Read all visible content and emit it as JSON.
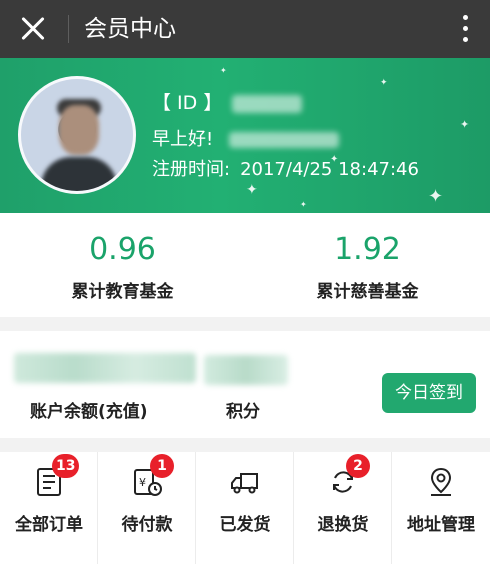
{
  "topbar": {
    "title": "会员中心"
  },
  "profile": {
    "id_label": "【 ID 】",
    "greeting": "早上好!",
    "reg_label": "注册时间:",
    "reg_time": "2017/4/25 18:47:46"
  },
  "funds": [
    {
      "value": "0.96",
      "label": "累计教育基金"
    },
    {
      "value": "1.92",
      "label": "累计慈善基金"
    }
  ],
  "balance": {
    "balance_label": "账户余额(充值)",
    "points_label": "积分",
    "checkin_label": "今日签到"
  },
  "orders": [
    {
      "label": "全部订单",
      "icon": "order-list-icon",
      "badge": "13"
    },
    {
      "label": "待付款",
      "icon": "payment-pending-icon",
      "badge": "1"
    },
    {
      "label": "已发货",
      "icon": "truck-icon",
      "badge": ""
    },
    {
      "label": "退换货",
      "icon": "return-exchange-icon",
      "badge": "2"
    },
    {
      "label": "地址管理",
      "icon": "location-pin-icon",
      "badge": ""
    }
  ],
  "colors": {
    "brand_green": "#22a86f",
    "topbar": "#3a3a3a",
    "badge_red": "#e8202a"
  }
}
